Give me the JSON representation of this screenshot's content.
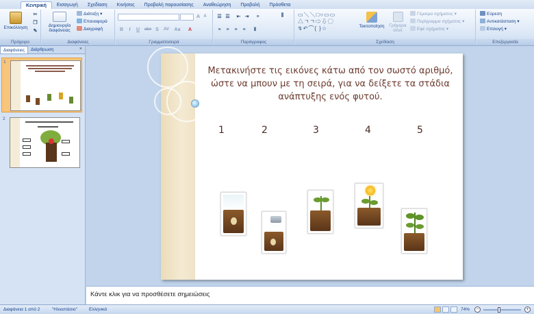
{
  "ribbon_tabs": [
    "Κεντρική",
    "Εισαγωγή",
    "Σχεδίαση",
    "Κινήσεις",
    "Προβολή παρουσίασης",
    "Αναθεώρηση",
    "Προβολή",
    "Πρόσθετα"
  ],
  "groups": {
    "clipboard": {
      "label": "Πρόχειρο",
      "paste": "Επικόλληση"
    },
    "slides": {
      "label": "Διαφάνειες",
      "new_slide": "Δημιουργία διαφάνειας",
      "layout": "Διάταξη",
      "reset": "Επαναφορά",
      "delete": "Διαγραφή"
    },
    "font": {
      "label": "Γραμματοσειρά",
      "size_up": "A",
      "size_down": "A",
      "case": "Aa",
      "bold": "B",
      "italic": "I",
      "underline": "U",
      "strike": "abe",
      "shadow": "S",
      "spacing": "AV"
    },
    "paragraph": {
      "label": "Παράγραφος"
    },
    "drawing": {
      "label": "Σχεδίαση",
      "arrange": "Τακτοποίηση",
      "quick_styles": "Γρήγορα στυλ",
      "fill": "Γέμισμα σχήματος",
      "outline": "Περίγραμμα σχήματος",
      "effects": "Εφέ σχήματος"
    },
    "editing": {
      "label": "Επεξεργασία",
      "find": "Εύρεση",
      "replace": "Αντικατάσταση",
      "select": "Επιλογή"
    }
  },
  "pane": {
    "tab_slides": "Διαφάνειες",
    "tab_outline": "Διάρθρωση",
    "close": "×",
    "thumb1_num": "1",
    "thumb2_num": "2"
  },
  "slide": {
    "title": "Μετακινήστε  τις εικόνες κάτω από τον σωστό αριθμό, ώστε να μπουν με τη σειρά, για να δείξετε τα στάδια ανάπτυξης ενός φυτού.",
    "numbers": [
      "1",
      "2",
      "3",
      "4",
      "5"
    ]
  },
  "notes": "Κάντε κλικ για να προσθέσετε σημειώσεις",
  "status": {
    "slide": "Διαφάνεια 1 από 2",
    "theme": "\"Ηλιοστάσιο\"",
    "lang": "Ελληνικά",
    "zoom": "74%",
    "minus": "−",
    "plus": "+"
  },
  "colors": {
    "accent": "#15428b",
    "title_text": "#6b3a2e",
    "ribbon_bg": "#dbe7f6"
  }
}
